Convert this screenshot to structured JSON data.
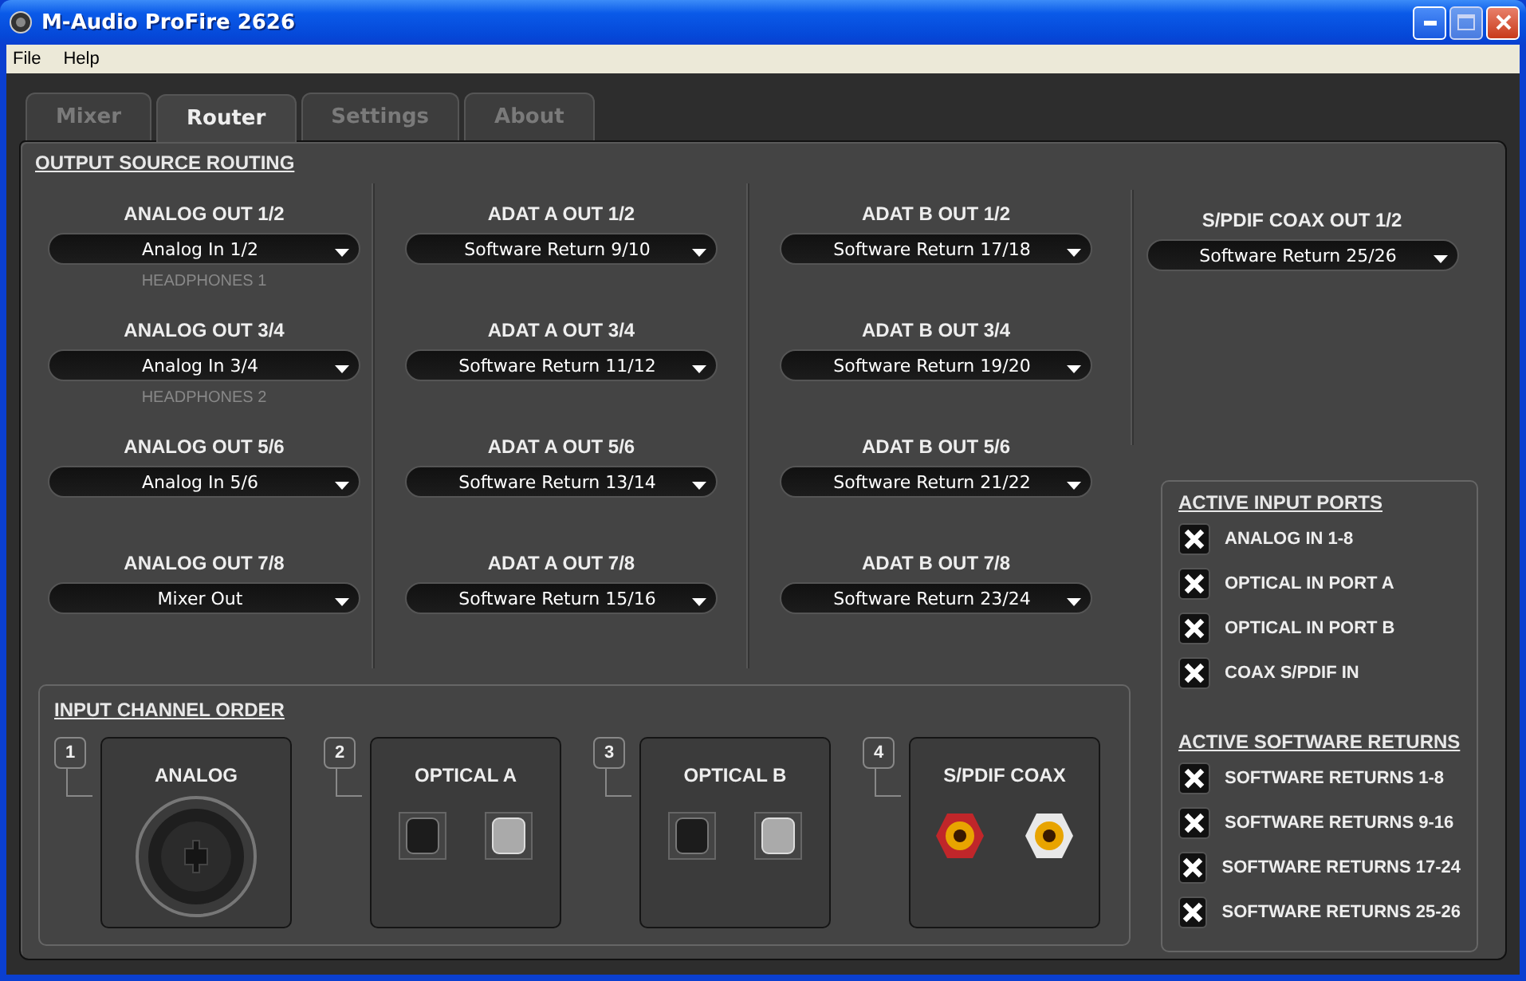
{
  "window": {
    "title": "M-Audio ProFire 2626"
  },
  "menu": [
    "File",
    "Help"
  ],
  "tabs": [
    {
      "label": "Mixer",
      "selected": false
    },
    {
      "label": "Router",
      "selected": true
    },
    {
      "label": "Settings",
      "selected": false
    },
    {
      "label": "About",
      "selected": false
    }
  ],
  "routing": {
    "title": "OUTPUT SOURCE ROUTING",
    "columns": [
      [
        {
          "label": "ANALOG OUT 1/2",
          "value": "Analog In 1/2",
          "note": "HEADPHONES 1"
        },
        {
          "label": "ANALOG OUT 3/4",
          "value": "Analog In 3/4",
          "note": "HEADPHONES 2"
        },
        {
          "label": "ANALOG OUT 5/6",
          "value": "Analog In 5/6"
        },
        {
          "label": "ANALOG OUT 7/8",
          "value": "Mixer Out"
        }
      ],
      [
        {
          "label": "ADAT A OUT 1/2",
          "value": "Software Return 9/10"
        },
        {
          "label": "ADAT A OUT 3/4",
          "value": "Software Return 11/12"
        },
        {
          "label": "ADAT A OUT 5/6",
          "value": "Software Return 13/14"
        },
        {
          "label": "ADAT A OUT 7/8",
          "value": "Software Return 15/16"
        }
      ],
      [
        {
          "label": "ADAT B OUT 1/2",
          "value": "Software Return 17/18"
        },
        {
          "label": "ADAT B OUT 3/4",
          "value": "Software Return 19/20"
        },
        {
          "label": "ADAT B OUT 5/6",
          "value": "Software Return 21/22"
        },
        {
          "label": "ADAT B OUT 7/8",
          "value": "Software Return 23/24"
        }
      ],
      [
        {
          "label": "S/PDIF COAX OUT 1/2",
          "value": "Software Return 25/26"
        }
      ]
    ]
  },
  "input_order": {
    "title": "INPUT CHANNEL ORDER",
    "slots": [
      {
        "number": "1",
        "label": "ANALOG",
        "kind": "combo"
      },
      {
        "number": "2",
        "label": "OPTICAL A",
        "kind": "optical"
      },
      {
        "number": "3",
        "label": "OPTICAL B",
        "kind": "optical"
      },
      {
        "number": "4",
        "label": "S/PDIF COAX",
        "kind": "coax"
      }
    ]
  },
  "active_inputs": {
    "title": "ACTIVE INPUT PORTS",
    "items": [
      {
        "label": "ANALOG IN 1-8",
        "checked": true
      },
      {
        "label": "OPTICAL IN PORT A",
        "checked": true
      },
      {
        "label": "OPTICAL IN PORT B",
        "checked": true
      },
      {
        "label": "COAX S/PDIF IN",
        "checked": true
      }
    ]
  },
  "active_returns": {
    "title": "ACTIVE SOFTWARE RETURNS",
    "items": [
      {
        "label": "SOFTWARE RETURNS 1-8",
        "checked": true
      },
      {
        "label": "SOFTWARE RETURNS 9-16",
        "checked": true
      },
      {
        "label": "SOFTWARE RETURNS 17-24",
        "checked": true
      },
      {
        "label": "SOFTWARE RETURNS 25-26",
        "checked": true
      }
    ]
  }
}
